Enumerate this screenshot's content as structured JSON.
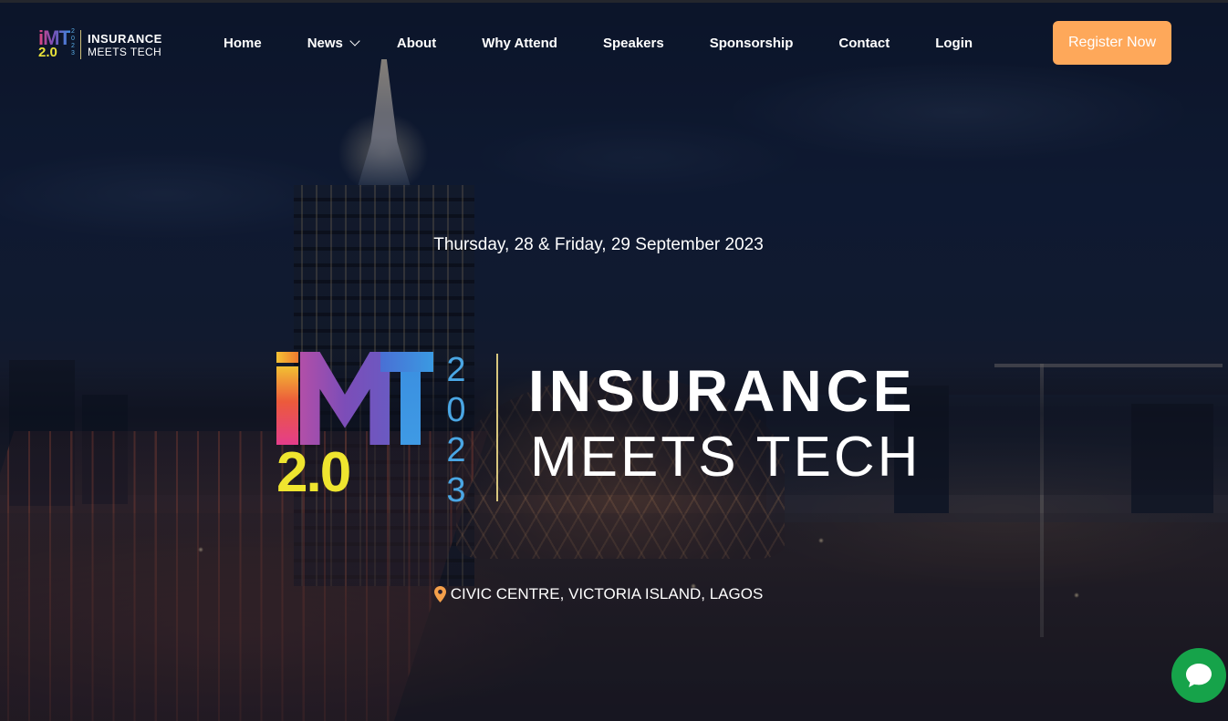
{
  "nav": {
    "logo": {
      "mark_top": "iMT",
      "mark_version": "2.0",
      "mark_year": [
        "2",
        "0",
        "2",
        "3"
      ],
      "line1": "INSURANCE",
      "line2": "MEETS TECH"
    },
    "links": [
      {
        "label": "Home"
      },
      {
        "label": "News",
        "has_dropdown": true
      },
      {
        "label": "About"
      },
      {
        "label": "Why Attend"
      },
      {
        "label": "Speakers"
      },
      {
        "label": "Sponsorship"
      },
      {
        "label": "Contact"
      },
      {
        "label": "Login"
      }
    ],
    "cta": "Register Now"
  },
  "hero": {
    "date": "Thursday, 28 & Friday, 29 September 2023",
    "logo": {
      "version": "2.0",
      "year": [
        "2",
        "0",
        "2",
        "3"
      ],
      "line1": "INSURANCE",
      "line2": "MEETS TECH"
    },
    "location": "CIVIC CENTRE, VICTORIA ISLAND, LAGOS",
    "location_icon": "map-pin-icon"
  },
  "chat": {
    "icon": "chat-bubble-icon"
  },
  "colors": {
    "accent": "#fea85a",
    "logo_yellow": "#efe52f",
    "logo_blue": "#4aa6e4",
    "logo_purple": "#7c4db8",
    "chat_green": "#16a34a",
    "pin_orange": "#f5a04a"
  }
}
